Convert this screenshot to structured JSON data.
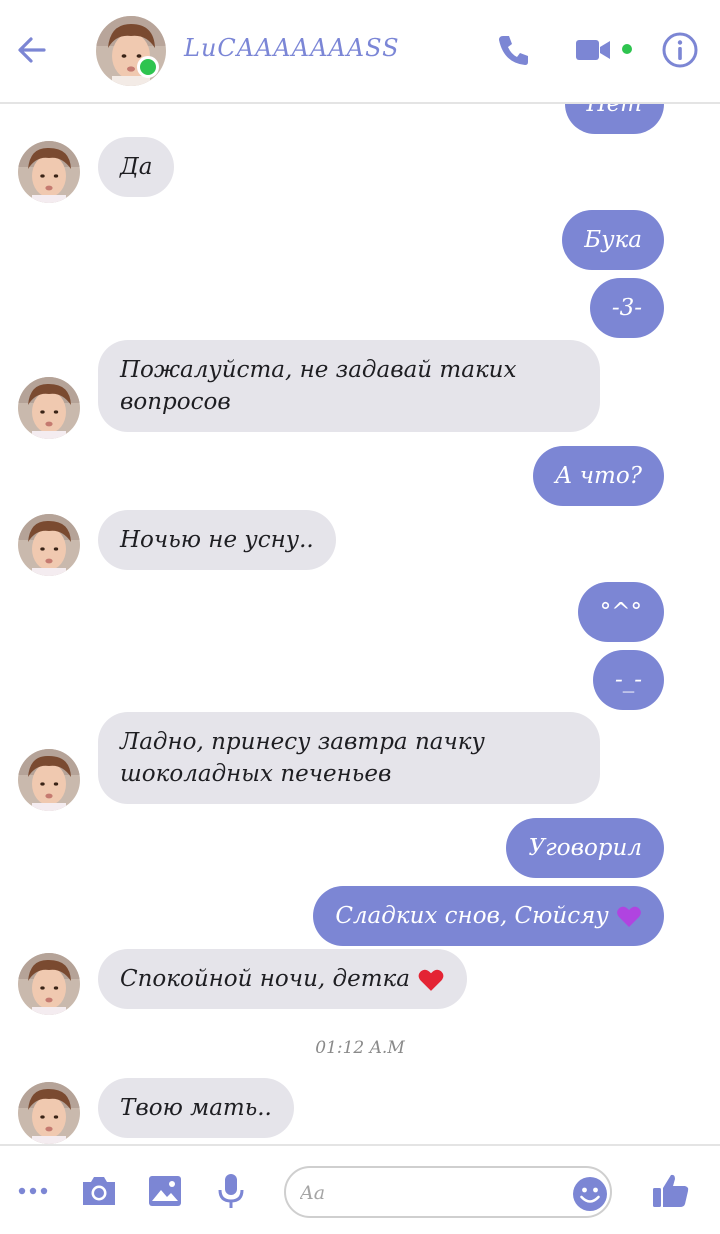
{
  "header": {
    "contact_name": "LuCAAAAAAASS",
    "contact_online": true,
    "back_icon": "arrow-left-icon",
    "call_icon": "phone-icon",
    "video_icon": "video-camera-icon",
    "info_icon": "info-circle-icon"
  },
  "messages": [
    {
      "from": "me",
      "text": "Нет",
      "partial": true
    },
    {
      "from": "them",
      "text": "Да"
    },
    {
      "from": "me",
      "text": "Бука"
    },
    {
      "from": "me",
      "text": "-3-"
    },
    {
      "from": "them",
      "text": "Пожалуйста, не задавай таких вопросов"
    },
    {
      "from": "me",
      "text": "А что?"
    },
    {
      "from": "them",
      "text": "Ночью не усну.."
    },
    {
      "from": "me",
      "text": "°^°"
    },
    {
      "from": "me",
      "text": "-_-"
    },
    {
      "from": "them",
      "text": "Ладно, принесу завтра пачку шоколадных печеньев"
    },
    {
      "from": "me",
      "text": "Уговорил"
    },
    {
      "from": "me",
      "text": "Сладких снов, Сюйсяу",
      "emoji": "purple-heart"
    },
    {
      "from": "them",
      "text": "Спокойной ночи, детка",
      "emoji": "red-heart"
    },
    {
      "from": "them",
      "text": "Твою мать.."
    }
  ],
  "timestamp": "01:12 A.M",
  "composer": {
    "placeholder": "Aa",
    "icons": [
      "more-dots-icon",
      "camera-icon",
      "image-icon",
      "microphone-icon",
      "emoji-icon",
      "thumbs-up-icon"
    ]
  },
  "colors": {
    "accent": "#7c86d4",
    "outgoing_bubble": "#7c86d4",
    "incoming_bubble": "#e5e4ea",
    "online": "#2ec44f",
    "header_text": "#7b86d6"
  }
}
